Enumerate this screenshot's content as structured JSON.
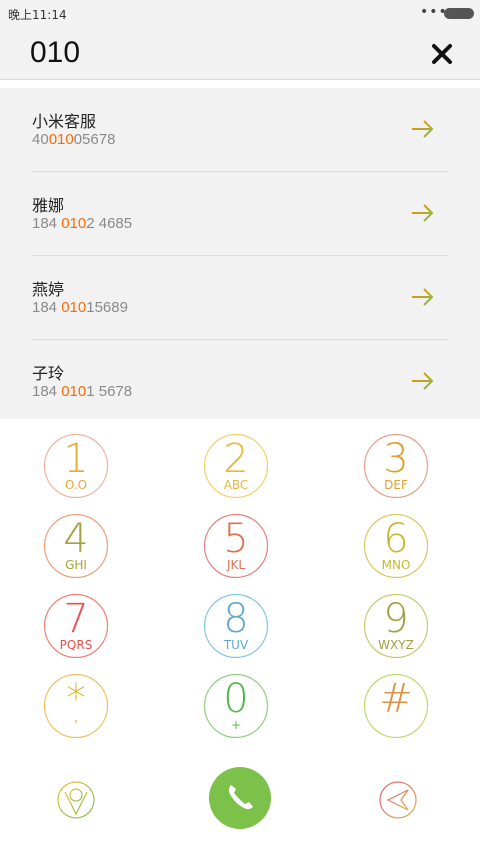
{
  "status": {
    "time": "晚上11:14",
    "dots": "•••"
  },
  "dial": {
    "number": "010"
  },
  "results": [
    {
      "name": "小米客服",
      "num_pre": "40",
      "num_hl": "010",
      "num_post": "05678"
    },
    {
      "name": "雅娜",
      "num_pre": "184 ",
      "num_hl": "010",
      "num_post": "2 4685"
    },
    {
      "name": "燕婷",
      "num_pre": "184 ",
      "num_hl": "010",
      "num_post": "15689"
    },
    {
      "name": "子玲",
      "num_pre": "184 ",
      "num_hl": "010",
      "num_post": "1 5678"
    }
  ],
  "keys": [
    {
      "digit": "1",
      "letters": "O.O",
      "ring": "#f2b3a0",
      "color": "#e8a93a"
    },
    {
      "digit": "2",
      "letters": "ABC",
      "ring": "#f2d16a",
      "color": "#e8b83a"
    },
    {
      "digit": "3",
      "letters": "DEF",
      "ring": "#e9a08a",
      "color": "#e0a030"
    },
    {
      "digit": "4",
      "letters": "GHI",
      "ring": "#f0a07a",
      "color": "#a8a040"
    },
    {
      "digit": "5",
      "letters": "JKL",
      "ring": "#e88080",
      "color": "#e07050"
    },
    {
      "digit": "6",
      "letters": "MNO",
      "ring": "#d8c860",
      "color": "#c8b830"
    },
    {
      "digit": "7",
      "letters": "PQRS",
      "ring": "#f08070",
      "color": "#e85050"
    },
    {
      "digit": "8",
      "letters": "TUV",
      "ring": "#80c8e0",
      "color": "#60a8d0"
    },
    {
      "digit": "9",
      "letters": "WXYZ",
      "ring": "#c8c870",
      "color": "#a0a040"
    },
    {
      "digit": "*",
      "letters": "'",
      "ring": "#f0c060",
      "color": "#d8b020"
    },
    {
      "digit": "0",
      "letters": "+",
      "ring": "#90d080",
      "color": "#50b848"
    },
    {
      "digit": "#",
      "letters": "",
      "ring": "#c0d870",
      "color": "#e09040"
    }
  ],
  "colors": {
    "highlight": "#ff6a00",
    "call": "#7cc14a"
  }
}
